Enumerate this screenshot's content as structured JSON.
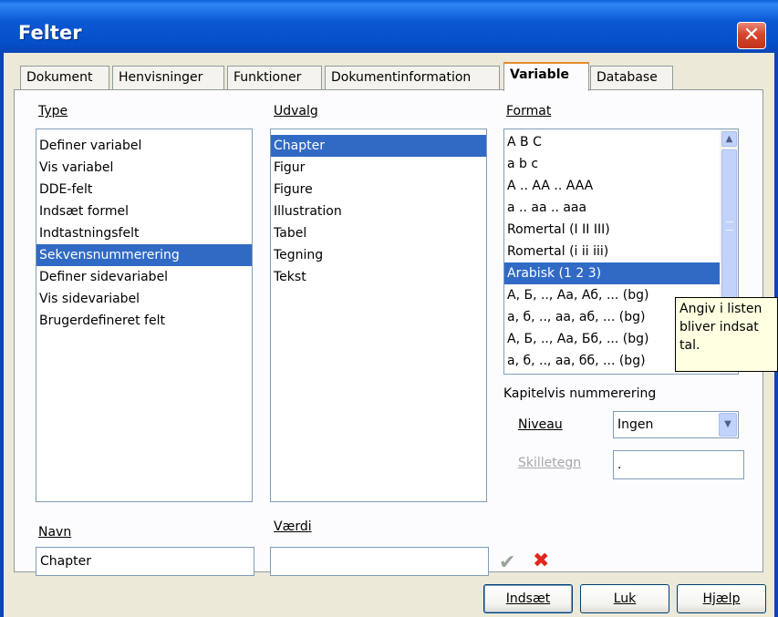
{
  "window": {
    "title": "Felter",
    "close_icon": "close-icon"
  },
  "tabs": [
    {
      "label": "Dokument",
      "active": false
    },
    {
      "label": "Henvisninger",
      "active": false
    },
    {
      "label": "Funktioner",
      "active": false
    },
    {
      "label": "Dokumentinformation",
      "active": false
    },
    {
      "label": "Variable",
      "active": true
    },
    {
      "label": "Database",
      "active": false
    }
  ],
  "type": {
    "label": "Type",
    "items": [
      "Definer variabel",
      "Vis variabel",
      "DDE-felt",
      "Indsæt formel",
      "Indtastningsfelt",
      "Sekvensnummerering",
      "Definer sidevariabel",
      "Vis sidevariabel",
      "Brugerdefineret felt"
    ],
    "selected": "Sekvensnummerering"
  },
  "udvalg": {
    "label": "Udvalg",
    "items": [
      "Chapter",
      "Figur",
      "Figure",
      "Illustration",
      "Tabel",
      "Tegning",
      "Tekst"
    ],
    "selected": "Chapter"
  },
  "format": {
    "label": "Format",
    "items": [
      "A B C",
      "a b c",
      "A .. AA .. AAA",
      "a .. aa .. aaa",
      "Romertal (I II III)",
      "Romertal (i ii iii)",
      "Arabisk (1 2 3)",
      "А, Б, .., Аа, Аб, ... (bg)",
      "а, б, .., аа, аб, ... (bg)",
      "А, Б, .., Аа, Бб, ... (bg)",
      "а, б, .., аа, бб, ... (bg)"
    ],
    "selected": "Arabisk (1 2 3)"
  },
  "tooltip": {
    "lines": [
      "Angiv i listen",
      "bliver indsat",
      "tal."
    ]
  },
  "kapitel": {
    "heading": "Kapitelvis nummerering",
    "niveau_label": "Niveau",
    "niveau_value": "Ingen",
    "skilletegn_label": "Skilletegn",
    "skilletegn_value": "."
  },
  "navn": {
    "label": "Navn",
    "value": "Chapter"
  },
  "vaerdi": {
    "label": "Værdi",
    "value": ""
  },
  "icons": {
    "apply": "check-icon",
    "delete": "delete-icon"
  },
  "colors": {
    "apply": "#9aa39a",
    "delete": "#e0271c",
    "selection": "#316ac5"
  },
  "buttons": {
    "insert": "Indsæt",
    "close": "Luk",
    "help": "Hjælp"
  }
}
